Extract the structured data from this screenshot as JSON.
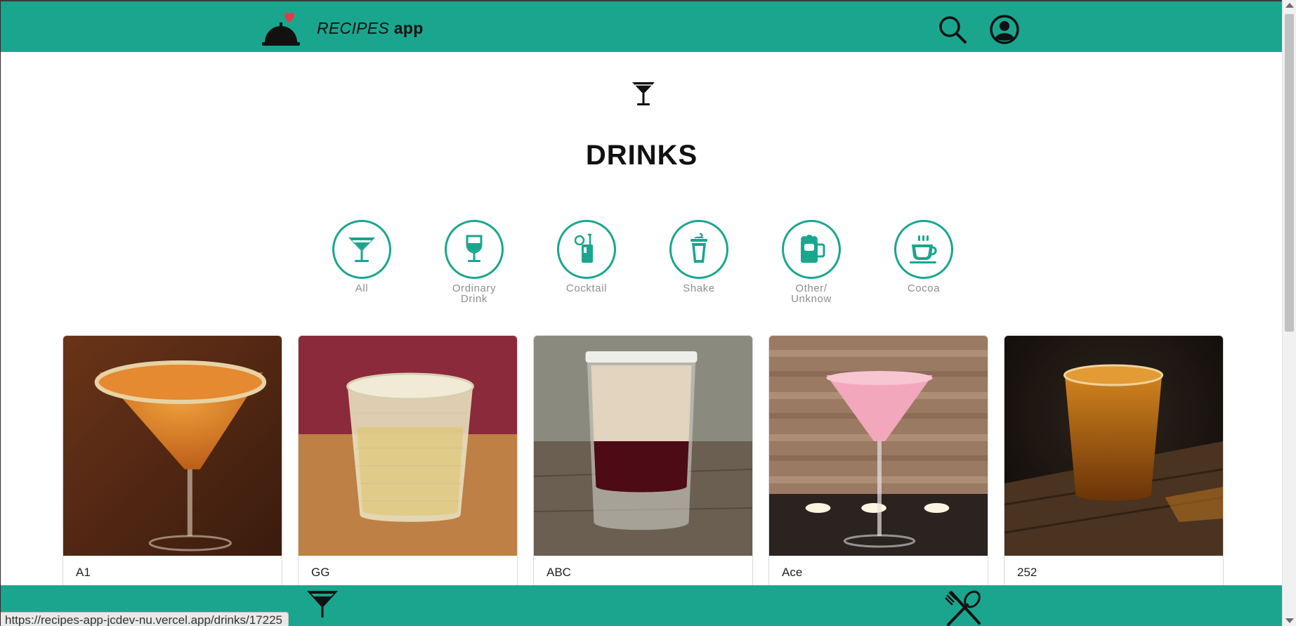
{
  "header": {
    "brand_italic": "RECIPES",
    "brand_bold": "app",
    "icons": [
      "cloche-heart-logo-icon",
      "search-icon",
      "profile-icon"
    ],
    "colors": {
      "bar": "#1aa68e",
      "heart": "#e53a46"
    }
  },
  "page": {
    "title": "DRINKS",
    "icon": "martini-glass-icon"
  },
  "categories": [
    {
      "label": "All",
      "icon": "cocktail-glass-icon"
    },
    {
      "label": "Ordinary\nDrink",
      "icon": "wine-glass-icon"
    },
    {
      "label": "Cocktail",
      "icon": "straw-drink-icon"
    },
    {
      "label": "Shake",
      "icon": "shake-cup-icon"
    },
    {
      "label": "Other/\nUnknow",
      "icon": "beer-mug-icon"
    },
    {
      "label": "Cocoa",
      "icon": "hot-cup-icon"
    }
  ],
  "recipes": [
    {
      "name": "A1"
    },
    {
      "name": "GG"
    },
    {
      "name": "ABC"
    },
    {
      "name": "Ace"
    },
    {
      "name": "252"
    }
  ],
  "footer": {
    "icons": [
      "drinks-nav-icon",
      "meals-nav-icon"
    ]
  },
  "status_url": "https://recipes-app-jcdev-nu.vercel.app/drinks/17225"
}
